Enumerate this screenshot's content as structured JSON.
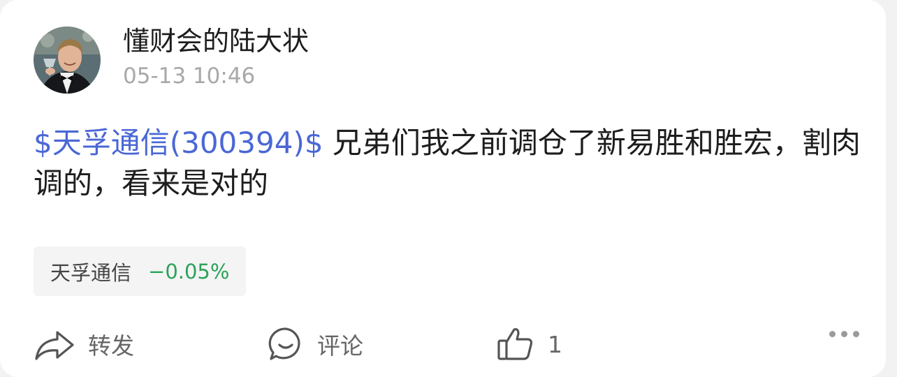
{
  "post": {
    "author": "懂财会的陆大状",
    "timestamp": "05-13 10:46",
    "stock_link": "$天孚通信(300394)$",
    "body_text": " 兄弟们我之前调仓了新易胜和胜宏，割肉调的，看来是对的"
  },
  "stock_chip": {
    "name": "天孚通信",
    "change": "−0.05%",
    "change_color": "#2aa25a"
  },
  "actions": {
    "repost_label": "转发",
    "comment_label": "评论",
    "like_count": "1"
  },
  "icons": [
    "avatar",
    "share-icon",
    "comment-icon",
    "thumbs-up-icon",
    "more-icon"
  ],
  "colors": {
    "link": "#4a67d6",
    "muted": "#a8a8a8"
  }
}
